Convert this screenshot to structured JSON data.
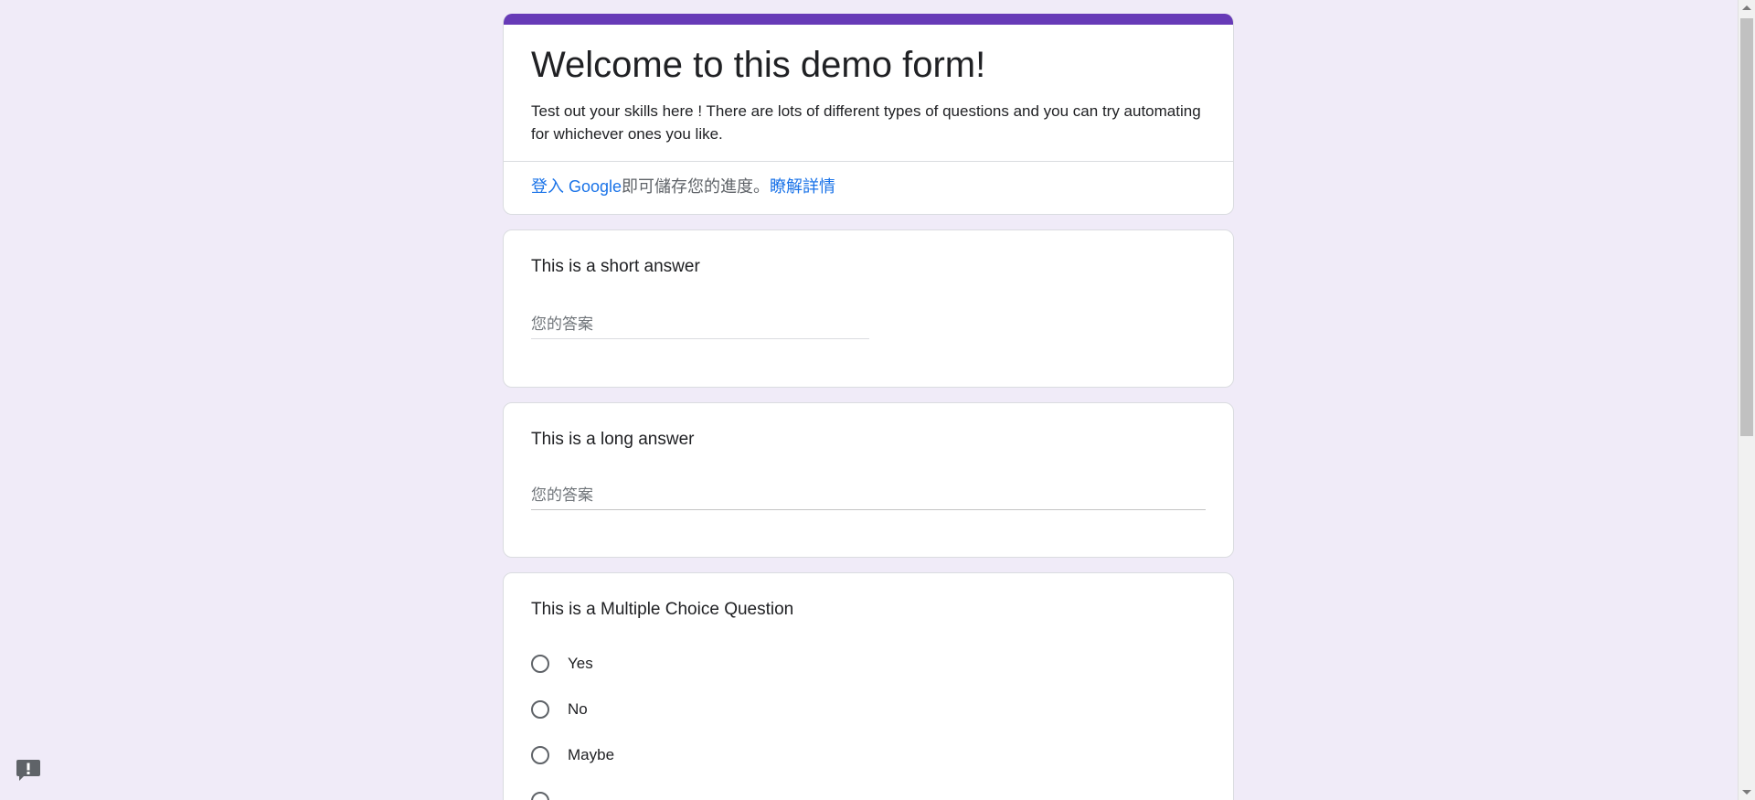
{
  "colors": {
    "accent": "#673ab7",
    "background": "#f0ebf8",
    "link": "#1a73e8"
  },
  "header": {
    "title": "Welcome to this demo form!",
    "description": "Test out your skills here ! There are lots of different types of questions and you can try automating for whichever ones you like.",
    "signin_link": "登入 Google",
    "signin_text": "即可儲存您的進度。",
    "learn_more": "瞭解詳情"
  },
  "questions": {
    "short": {
      "title": "This is a short answer",
      "placeholder": "您的答案"
    },
    "long": {
      "title": "This is a long answer",
      "placeholder": "您的答案"
    },
    "mcq": {
      "title": "This is a Multiple Choice Question",
      "options": [
        "Yes",
        "No",
        "Maybe"
      ]
    }
  },
  "feedback_icon": "report-feedback-icon"
}
